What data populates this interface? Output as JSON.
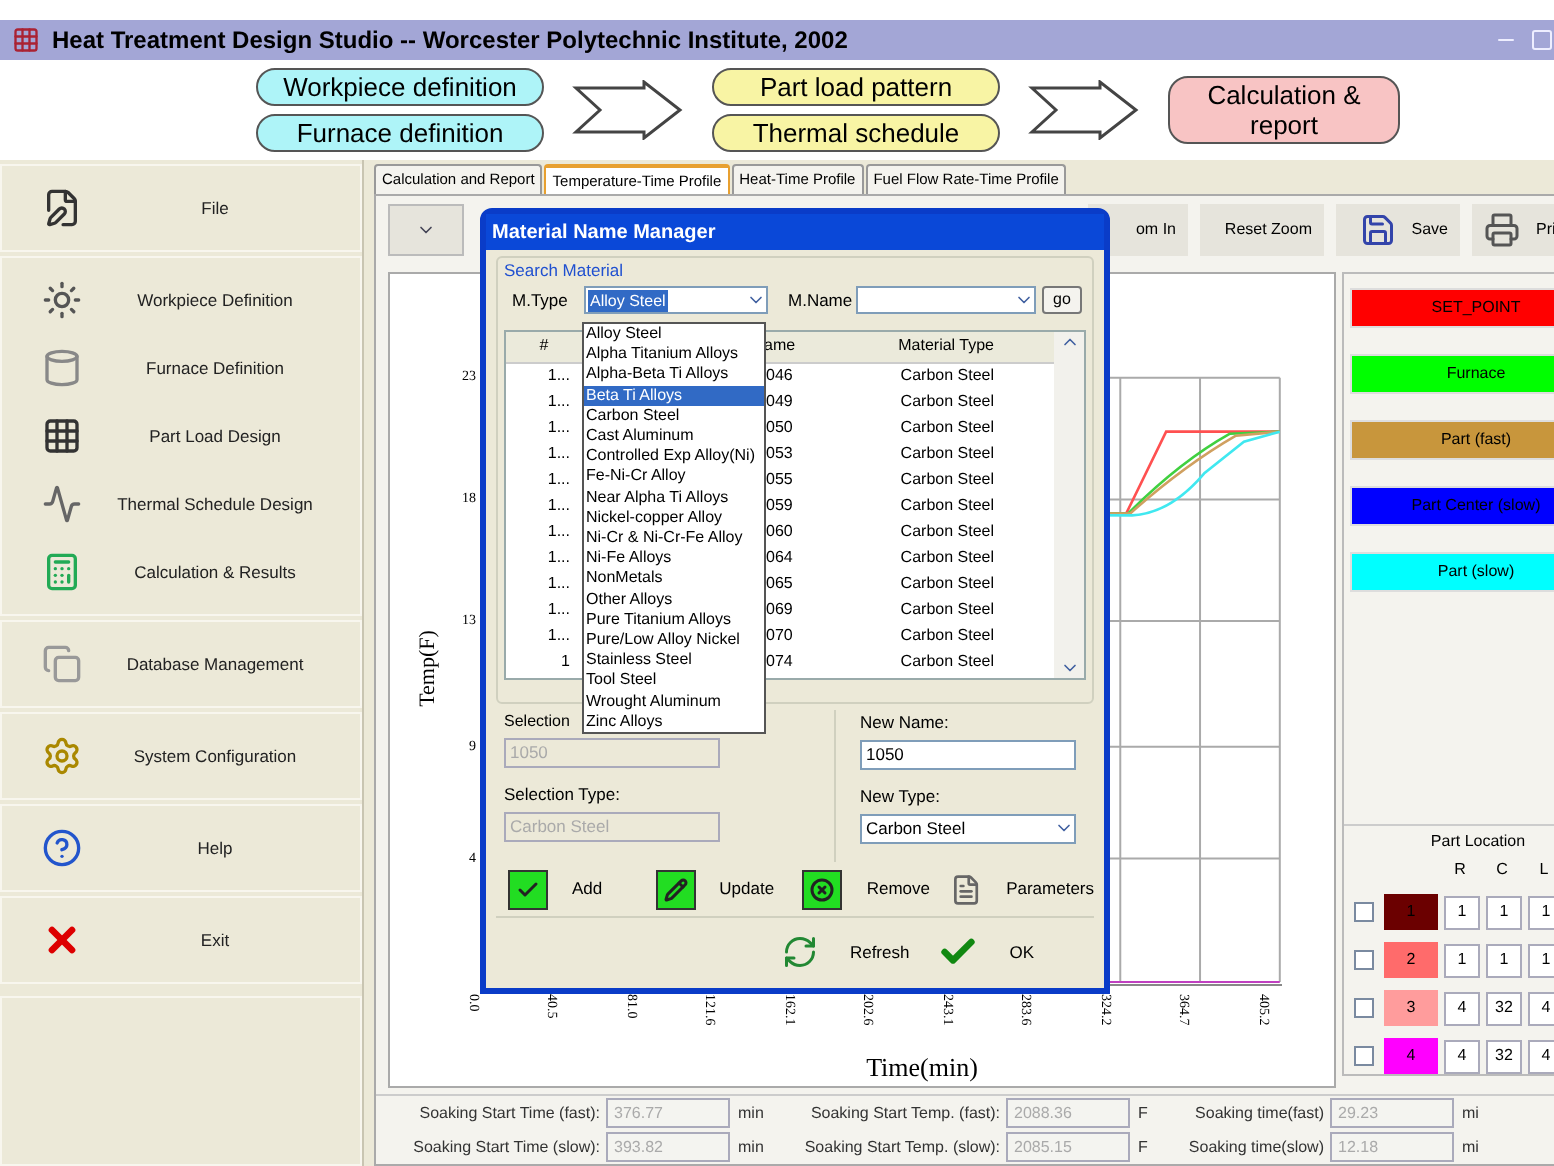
{
  "window": {
    "title": "Heat Treatment Design Studio -- Worcester Polytechnic Institute, 2002"
  },
  "workflow": [
    {
      "kind": "pair",
      "color": "#aef4f8",
      "steps": [
        "Workpiece definition",
        "Furnace definition"
      ]
    },
    {
      "kind": "pair",
      "color": "#f8f4a4",
      "steps": [
        "Part load pattern",
        "Thermal schedule"
      ]
    },
    {
      "kind": "single",
      "color": "#f8c4c4",
      "steps": [
        "Calculation & report"
      ]
    }
  ],
  "sidebar": {
    "groups": [
      {
        "items": [
          {
            "label": "File"
          }
        ]
      },
      {
        "items": [
          {
            "label": "Workpiece Definition"
          },
          {
            "label": "Furnace Definition"
          },
          {
            "label": "Part Load Design"
          },
          {
            "label": "Thermal Schedule Design"
          },
          {
            "label": "Calculation & Results"
          }
        ]
      },
      {
        "items": [
          {
            "label": "Database Management"
          }
        ]
      },
      {
        "items": [
          {
            "label": "System Configuration"
          }
        ]
      },
      {
        "items": [
          {
            "label": "Help"
          }
        ]
      },
      {
        "items": [
          {
            "label": "Exit"
          }
        ]
      }
    ]
  },
  "tabs": [
    {
      "label": "Calculation and Report",
      "selected": false
    },
    {
      "label": "Temperature-Time Profile",
      "selected": true
    },
    {
      "label": "Heat-Time Profile",
      "selected": false
    },
    {
      "label": "Fuel Flow Rate-Time Profile",
      "selected": false
    }
  ],
  "toolbar": [
    {
      "kind": "zoom",
      "label": "om In"
    },
    {
      "kind": "reset",
      "label": "Reset Zoom"
    },
    {
      "kind": "save",
      "label": "Save"
    },
    {
      "kind": "print",
      "label": "Pri"
    }
  ],
  "chart": {
    "ylabel": "Temp(F)",
    "xlabel": "Time(min)",
    "yticks": [
      "23",
      "18",
      "13",
      "9",
      "4"
    ],
    "xticks": [
      "0.0",
      "40.5",
      "81.0",
      "121.6",
      "162.1",
      "202.6",
      "243.1",
      "283.6",
      "324.2",
      "364.7",
      "405.2"
    ]
  },
  "legend": [
    {
      "label": "SET_POINT",
      "color": "#ff0000"
    },
    {
      "label": "Furnace",
      "color": "#00ff00"
    },
    {
      "label": "Part (fast)",
      "color": "#c8963c"
    },
    {
      "label": "Part Center (slow)",
      "color": "#0000ff"
    },
    {
      "label": "Part (slow)",
      "color": "#00ffff"
    }
  ],
  "part_location": {
    "title": "Part Location",
    "columns": [
      "R",
      "C",
      "L"
    ],
    "rows": [
      {
        "number": "1",
        "color": "#6b0000",
        "checked": false,
        "values": [
          "1",
          "1",
          "1"
        ]
      },
      {
        "number": "2",
        "color": "#ff6b6b",
        "checked": false,
        "values": [
          "1",
          "1",
          "1"
        ]
      },
      {
        "number": "3",
        "color": "#ff9c9c",
        "checked": false,
        "values": [
          "4",
          "32",
          "4"
        ]
      },
      {
        "number": "4",
        "color": "#ff00ff",
        "checked": false,
        "values": [
          "4",
          "32",
          "4"
        ]
      }
    ]
  },
  "soaking": [
    [
      {
        "label": "Soaking Start Time (fast):",
        "value": "376.77",
        "unit": "min"
      },
      {
        "label": "Soaking Start Temp. (fast):",
        "value": "2088.36",
        "unit": "F"
      },
      {
        "label": "Soaking time(fast)",
        "value": "29.23",
        "unit": "mi"
      }
    ],
    [
      {
        "label": "Soaking Start Time (slow):",
        "value": "393.82",
        "unit": "min"
      },
      {
        "label": "Soaking Start Temp. (slow):",
        "value": "2085.15",
        "unit": "F"
      },
      {
        "label": "Soaking time(slow)",
        "value": "12.18",
        "unit": "mi"
      }
    ]
  ],
  "dialog": {
    "title": "Material Name Manager",
    "search_group": "Search Material",
    "mtype_label": "M.Type",
    "mtype_value": "Alloy Steel",
    "mname_label": "M.Name",
    "go": "go",
    "mtype_options": [
      {
        "label": "Alloy Steel",
        "selected": false
      },
      {
        "label": "Alpha Titanium Alloys",
        "selected": false
      },
      {
        "label": "Alpha-Beta Ti Alloys",
        "selected": false
      },
      {
        "label": "Beta Ti Alloys",
        "selected": true
      },
      {
        "label": "Carbon Steel",
        "selected": false
      },
      {
        "label": "Cast Aluminum",
        "selected": false
      },
      {
        "label": "Controlled Exp Alloy(Ni)",
        "selected": false
      },
      {
        "label": "Fe-Ni-Cr Alloy",
        "selected": false
      },
      {
        "label": "Near Alpha Ti Alloys",
        "selected": false
      },
      {
        "label": "Nickel-copper Alloy",
        "selected": false
      },
      {
        "label": "Ni-Cr & Ni-Cr-Fe Alloy",
        "selected": false
      },
      {
        "label": "Ni-Fe Alloys",
        "selected": false
      },
      {
        "label": "NonMetals",
        "selected": false
      },
      {
        "label": "Other Alloys",
        "selected": false
      },
      {
        "label": "Pure Titanium Alloys",
        "selected": false
      },
      {
        "label": "Pure/Low Alloy Nickel",
        "selected": false
      },
      {
        "label": "Stainless Steel",
        "selected": false
      },
      {
        "label": "Tool Steel",
        "selected": false
      },
      {
        "label": "Wrought Aluminum",
        "selected": false
      },
      {
        "label": "Zinc Alloys",
        "selected": false
      }
    ],
    "table": {
      "columns": [
        "#",
        "ame",
        "Material Type"
      ],
      "rows": [
        [
          "1...",
          "046",
          "Carbon Steel"
        ],
        [
          "1...",
          "049",
          "Carbon Steel"
        ],
        [
          "1...",
          "050",
          "Carbon Steel"
        ],
        [
          "1...",
          "053",
          "Carbon Steel"
        ],
        [
          "1...",
          "055",
          "Carbon Steel"
        ],
        [
          "1...",
          "059",
          "Carbon Steel"
        ],
        [
          "1...",
          "060",
          "Carbon Steel"
        ],
        [
          "1...",
          "064",
          "Carbon Steel"
        ],
        [
          "1...",
          "065",
          "Carbon Steel"
        ],
        [
          "1...",
          "069",
          "Carbon Steel"
        ],
        [
          "1...",
          "070",
          "Carbon Steel"
        ],
        [
          "1",
          "074",
          "Carbon Steel"
        ]
      ]
    },
    "selection_name_label": "Selection",
    "selection_name": "1050",
    "selection_type_label": "Selection Type:",
    "selection_type": "Carbon Steel",
    "new_name_label": "New Name:",
    "new_name": "1050",
    "new_type_label": "New Type:",
    "new_type": "Carbon Steel",
    "actions": [
      {
        "kind": "add",
        "label": "Add"
      },
      {
        "kind": "update",
        "label": "Update"
      },
      {
        "kind": "remove",
        "label": "Remove"
      },
      {
        "kind": "parameters",
        "label": "Parameters"
      }
    ],
    "footer": [
      {
        "kind": "refresh",
        "label": "Refresh"
      },
      {
        "kind": "ok",
        "label": "OK"
      }
    ]
  }
}
